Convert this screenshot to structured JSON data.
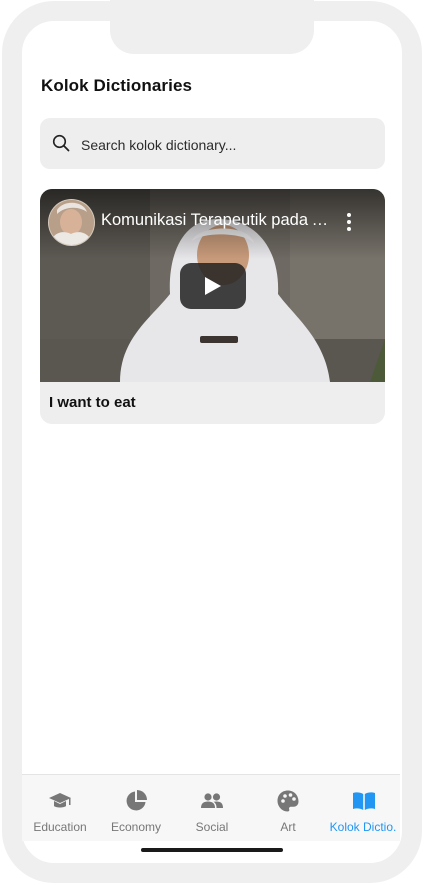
{
  "header": {
    "title": "Kolok Dictionaries"
  },
  "search": {
    "placeholder": "Search kolok dictionary..."
  },
  "video_card": {
    "video_title": "Komunikasi Terapeutik pada Anak",
    "label": "I want to eat"
  },
  "tabs": [
    {
      "label": "Education",
      "icon": "graduation-cap-icon"
    },
    {
      "label": "Economy",
      "icon": "pie-chart-icon"
    },
    {
      "label": "Social",
      "icon": "users-icon"
    },
    {
      "label": "Art",
      "icon": "palette-icon"
    },
    {
      "label": "Kolok Dictio.",
      "icon": "book-open-icon",
      "active": true
    }
  ],
  "colors": {
    "accent": "#2196f3",
    "inactive": "#777777",
    "surface": "#eeeeee"
  }
}
